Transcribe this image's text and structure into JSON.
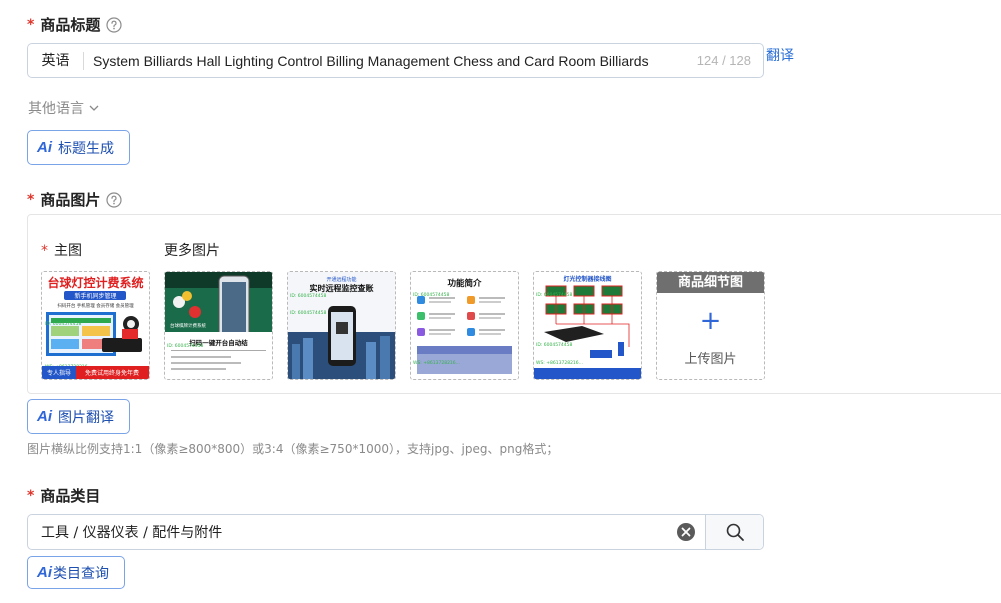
{
  "title_section": {
    "label": "商品标题",
    "lang": "英语",
    "value": "System Billiards Hall Lighting Control Billing Management Chess and Card Room Billiards",
    "counter": "124 / 128",
    "translate": "翻译",
    "other_lang": "其他语言",
    "ai_badge": "Ai",
    "ai_button": "标题生成"
  },
  "image_section": {
    "label": "商品图片",
    "main_label": "主图",
    "more_label": "更多图片",
    "thumb1": {
      "headline": "台球灯控计费系统",
      "tag": "新手机同步管理",
      "row1": "扫码开台  手机管理  会员存储  会员管理",
      "footer_left": "专人指导",
      "footer_right": "免费试用终身免年费"
    },
    "thumb2": {
      "caption": "扫码一键开台自动结",
      "sub": "台球棋牌计费系统"
    },
    "thumb3": {
      "top": "开通远程功能",
      "title": "实时远程监控查账"
    },
    "thumb4": {
      "title": "功能简介"
    },
    "thumb5": {
      "title": "灯光控制器接线图"
    },
    "watermark_id": "ID: 6004574458",
    "watermark_ws": "WS: +8613728216...",
    "upload_header": "商品细节图",
    "upload_plus": "+",
    "upload_text": "上传图片",
    "ai_badge": "Ai",
    "ai_button": "图片翻译",
    "hint": "图片横纵比例支持1:1（像素≥800*800）或3:4（像素≥750*1000），支持jpg、jpeg、png格式；"
  },
  "category_section": {
    "label": "商品类目",
    "value": "工具 / 仪器仪表 / 配件与附件",
    "ai_badge": "Ai",
    "ai_button": "类目查询"
  },
  "colors": {
    "accent": "#2f66d8",
    "required": "#e0352b",
    "border": "#c9d3e0"
  }
}
